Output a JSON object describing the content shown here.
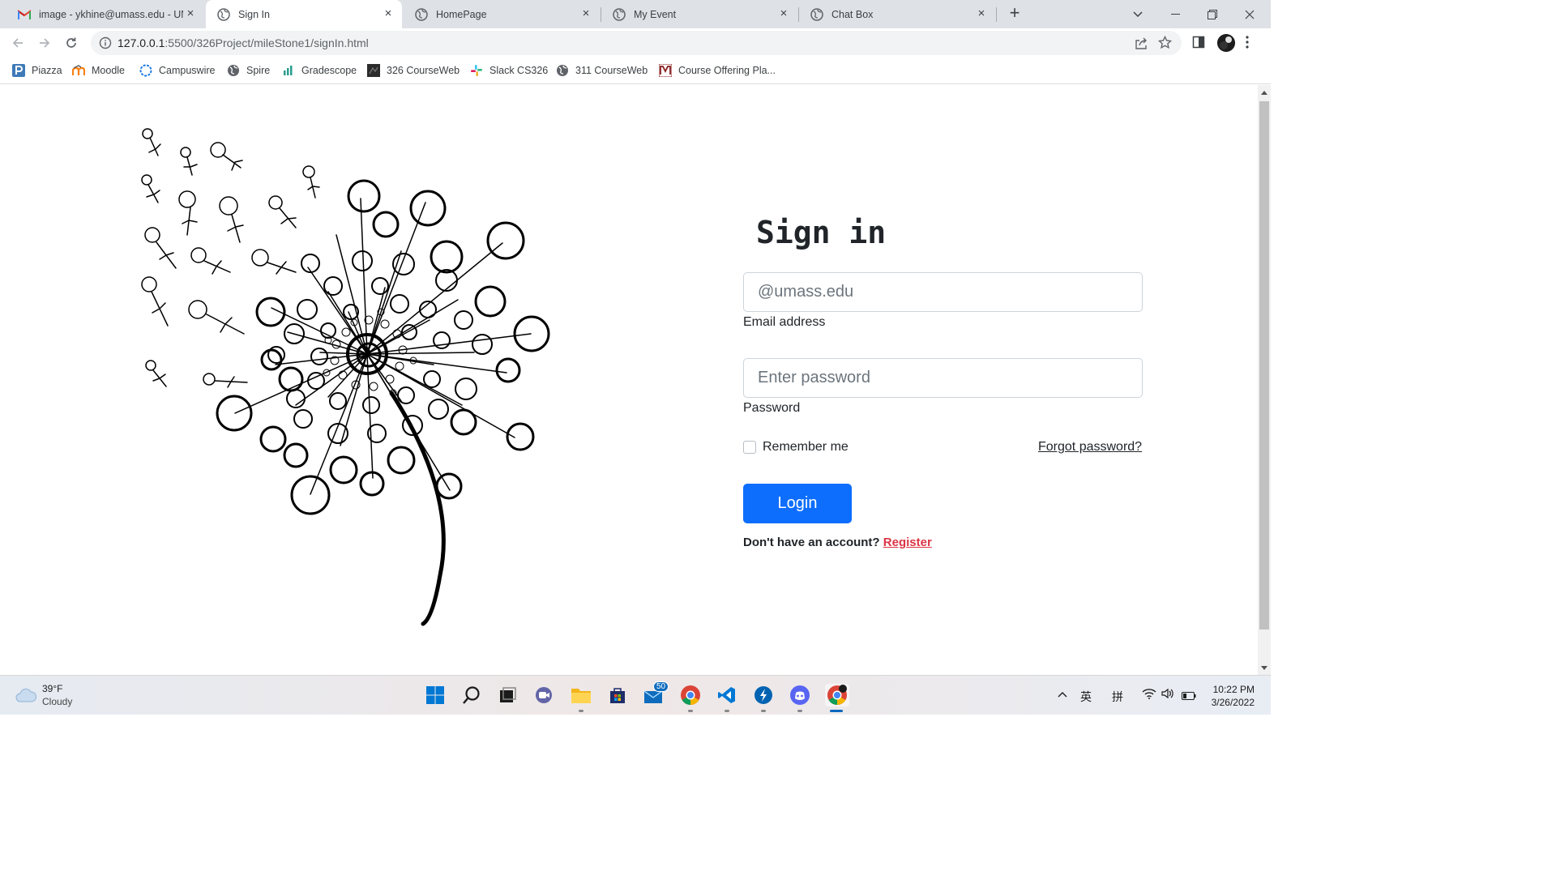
{
  "browser": {
    "tabs": [
      {
        "title": "image - ykhine@umass.edu - UMass Amherst Mail",
        "icon": "gmail-icon",
        "active": false
      },
      {
        "title": "Sign In",
        "icon": "globe-icon",
        "active": true
      },
      {
        "title": "HomePage",
        "icon": "globe-icon",
        "active": false
      },
      {
        "title": "My Event",
        "icon": "globe-icon",
        "active": false
      },
      {
        "title": "Chat Box",
        "icon": "globe-icon",
        "active": false
      }
    ],
    "url_host": "127.0.0.1",
    "url_rest": ":5500/326Project/mileStone1/signIn.html",
    "bookmarks": [
      {
        "label": "Piazza",
        "icon": "piazza-icon"
      },
      {
        "label": "Moodle",
        "icon": "moodle-icon"
      },
      {
        "label": "Campuswire",
        "icon": "campuswire-icon"
      },
      {
        "label": "Spire",
        "icon": "globe-icon"
      },
      {
        "label": "Gradescope",
        "icon": "gradescope-icon"
      },
      {
        "label": "326 CourseWeb",
        "icon": "courseweb-icon"
      },
      {
        "label": "Slack CS326",
        "icon": "slack-icon"
      },
      {
        "label": "311 CourseWeb",
        "icon": "globe-icon"
      },
      {
        "label": "Course Offering Pla...",
        "icon": "umass-icon"
      }
    ]
  },
  "signin": {
    "title": "Sign in",
    "email_placeholder": "@umass.edu",
    "email_label": "Email address",
    "password_placeholder": "Enter password",
    "password_label": "Password",
    "remember_label": "Remember me",
    "forgot_label": "Forgot password?",
    "login_label": "Login",
    "no_account_text": "Don't have an account?",
    "register_label": "Register"
  },
  "taskbar": {
    "weather_temp": "39°F",
    "weather_cond": "Cloudy",
    "mail_badge": "50",
    "ime_1": "英",
    "ime_2": "拼",
    "time": "10:22 PM",
    "date": "3/26/2022"
  },
  "colors": {
    "primary": "#0d6efd",
    "register": "#dc3545",
    "tabstrip": "#dee1e6"
  }
}
